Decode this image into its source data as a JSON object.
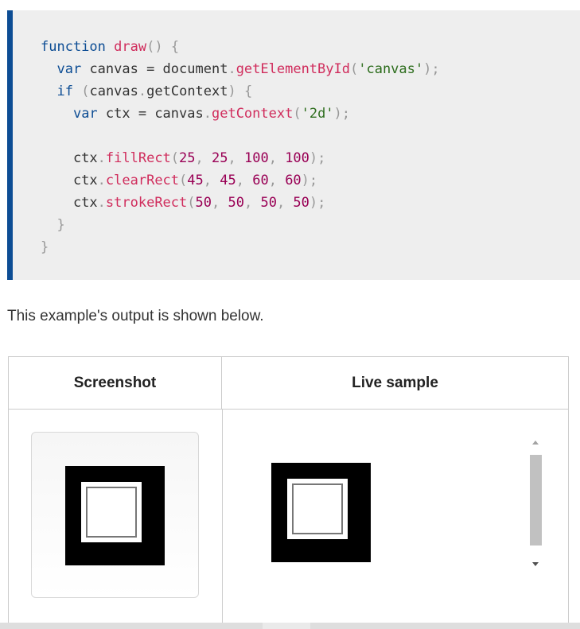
{
  "code": {
    "lines": [
      [
        [
          "kw",
          "function"
        ],
        [
          "plain",
          " "
        ],
        [
          "fn",
          "draw"
        ],
        [
          "pun",
          "()"
        ],
        [
          "plain",
          " "
        ],
        [
          "pun",
          "{"
        ]
      ],
      [
        [
          "plain",
          "  "
        ],
        [
          "kw",
          "var"
        ],
        [
          "plain",
          " canvas = document"
        ],
        [
          "pun",
          "."
        ],
        [
          "fn",
          "getElementById"
        ],
        [
          "pun",
          "("
        ],
        [
          "str",
          "'canvas'"
        ],
        [
          "pun",
          ");"
        ]
      ],
      [
        [
          "plain",
          "  "
        ],
        [
          "kw",
          "if"
        ],
        [
          "plain",
          " "
        ],
        [
          "pun",
          "("
        ],
        [
          "plain",
          "canvas"
        ],
        [
          "pun",
          "."
        ],
        [
          "plain",
          "getContext"
        ],
        [
          "pun",
          ")"
        ],
        [
          "plain",
          " "
        ],
        [
          "pun",
          "{"
        ]
      ],
      [
        [
          "plain",
          "    "
        ],
        [
          "kw",
          "var"
        ],
        [
          "plain",
          " ctx = canvas"
        ],
        [
          "pun",
          "."
        ],
        [
          "fn",
          "getContext"
        ],
        [
          "pun",
          "("
        ],
        [
          "str",
          "'2d'"
        ],
        [
          "pun",
          ");"
        ]
      ],
      [],
      [
        [
          "plain",
          "    ctx"
        ],
        [
          "pun",
          "."
        ],
        [
          "fn",
          "fillRect"
        ],
        [
          "pun",
          "("
        ],
        [
          "num",
          "25"
        ],
        [
          "pun",
          ", "
        ],
        [
          "num",
          "25"
        ],
        [
          "pun",
          ", "
        ],
        [
          "num",
          "100"
        ],
        [
          "pun",
          ", "
        ],
        [
          "num",
          "100"
        ],
        [
          "pun",
          ");"
        ]
      ],
      [
        [
          "plain",
          "    ctx"
        ],
        [
          "pun",
          "."
        ],
        [
          "fn",
          "clearRect"
        ],
        [
          "pun",
          "("
        ],
        [
          "num",
          "45"
        ],
        [
          "pun",
          ", "
        ],
        [
          "num",
          "45"
        ],
        [
          "pun",
          ", "
        ],
        [
          "num",
          "60"
        ],
        [
          "pun",
          ", "
        ],
        [
          "num",
          "60"
        ],
        [
          "pun",
          ");"
        ]
      ],
      [
        [
          "plain",
          "    ctx"
        ],
        [
          "pun",
          "."
        ],
        [
          "fn",
          "strokeRect"
        ],
        [
          "pun",
          "("
        ],
        [
          "num",
          "50"
        ],
        [
          "pun",
          ", "
        ],
        [
          "num",
          "50"
        ],
        [
          "pun",
          ", "
        ],
        [
          "num",
          "50"
        ],
        [
          "pun",
          ", "
        ],
        [
          "num",
          "50"
        ],
        [
          "pun",
          ");"
        ]
      ],
      [
        [
          "plain",
          "  "
        ],
        [
          "pun",
          "}"
        ]
      ],
      [
        [
          "pun",
          "}"
        ]
      ]
    ]
  },
  "description": "This example's output is shown below.",
  "table": {
    "header_screenshot": "Screenshot",
    "header_live": "Live sample"
  },
  "colors": {
    "code_border": "#0d4d94",
    "keyword": "#0d4d94",
    "function": "#d02c5c",
    "string": "#2d6d1d",
    "number": "#990055"
  }
}
